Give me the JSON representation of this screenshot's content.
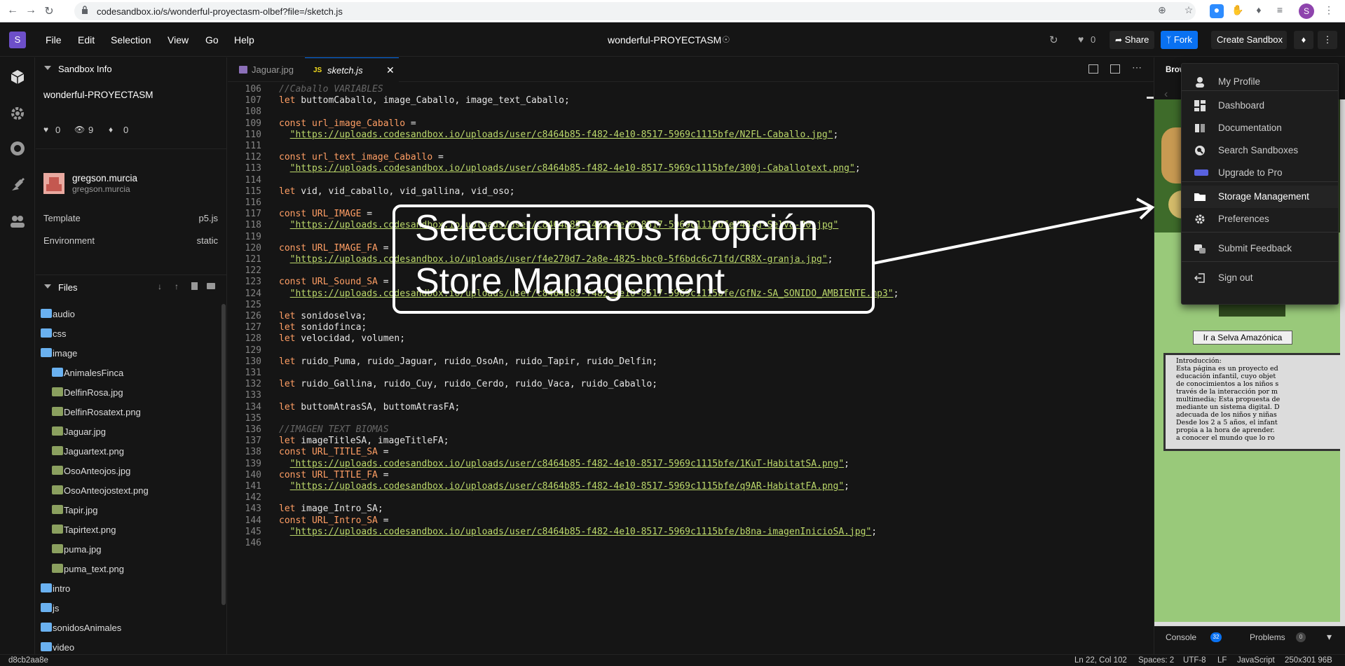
{
  "browser": {
    "url": "codesandbox.io/s/wonderful-proyectasm-olbef?file=/sketch.js",
    "profile_initial": "S"
  },
  "menubar": {
    "logo": "S",
    "items": [
      "File",
      "Edit",
      "Selection",
      "View",
      "Go",
      "Help"
    ],
    "sandbox_title": "wonderful-PROYECTASM",
    "likes": "0",
    "share_label": "Share",
    "fork_label": "Fork",
    "create_label": "Create Sandbox",
    "accent": "#0971f1"
  },
  "sidebar": {
    "info_header": "Sandbox Info",
    "sandbox_name": "wonderful-PROYECTASM",
    "stats": {
      "likes": "0",
      "views": "9",
      "forks": "0"
    },
    "author_name": "gregson.murcia",
    "author_handle": "gregson.murcia",
    "template_label": "Template",
    "template_value": "p5.js",
    "environment_label": "Environment",
    "environment_value": "static",
    "files_header": "Files",
    "files": [
      {
        "name": "audio",
        "type": "folder",
        "indent": 0
      },
      {
        "name": "css",
        "type": "folder",
        "indent": 0
      },
      {
        "name": "image",
        "type": "folder-open",
        "indent": 0
      },
      {
        "name": "AnimalesFinca",
        "type": "folder",
        "indent": 1
      },
      {
        "name": "DelfinRosa.jpg",
        "type": "image",
        "indent": 1
      },
      {
        "name": "DelfinRosatext.png",
        "type": "image",
        "indent": 1
      },
      {
        "name": "Jaguar.jpg",
        "type": "image",
        "indent": 1
      },
      {
        "name": "Jaguartext.png",
        "type": "image",
        "indent": 1
      },
      {
        "name": "OsoAnteojos.jpg",
        "type": "image",
        "indent": 1
      },
      {
        "name": "OsoAnteojostext.png",
        "type": "image",
        "indent": 1
      },
      {
        "name": "Tapir.jpg",
        "type": "image",
        "indent": 1
      },
      {
        "name": "Tapirtext.png",
        "type": "image",
        "indent": 1
      },
      {
        "name": "puma.jpg",
        "type": "image",
        "indent": 1
      },
      {
        "name": "puma_text.png",
        "type": "image",
        "indent": 1
      },
      {
        "name": "intro",
        "type": "folder",
        "indent": 0
      },
      {
        "name": "js",
        "type": "folder",
        "indent": 0
      },
      {
        "name": "sonidosAnimales",
        "type": "folder",
        "indent": 0
      },
      {
        "name": "video",
        "type": "folder",
        "indent": 0
      }
    ]
  },
  "tabs": [
    {
      "label": "Jaguar.jpg",
      "active": false
    },
    {
      "label": "sketch.js",
      "active": true
    }
  ],
  "code_lines": [
    {
      "n": "106",
      "html": "<span class=\"cm\">//Caballo VARIABLES</span>"
    },
    {
      "n": "107",
      "html": "<span class=\"kw\">let</span> buttomCaballo, image_Caballo, image_text_Caballo;"
    },
    {
      "n": "108",
      "html": ""
    },
    {
      "n": "109",
      "html": "<span class=\"kw\">const</span> <span class=\"kw\">url_image_Caballo</span> ="
    },
    {
      "n": "110",
      "html": "  <span class=\"str\">\"https://uploads.codesandbox.io/uploads/user/c8464b85-f482-4e10-8517-5969c1115bfe/N2FL-Caballo.jpg\"</span>;"
    },
    {
      "n": "111",
      "html": ""
    },
    {
      "n": "112",
      "html": "<span class=\"kw\">const</span> <span class=\"kw\">url_text_image_Caballo</span> ="
    },
    {
      "n": "113",
      "html": "  <span class=\"str\">\"https://uploads.codesandbox.io/uploads/user/c8464b85-f482-4e10-8517-5969c1115bfe/300j-Caballotext.png\"</span>;"
    },
    {
      "n": "114",
      "html": ""
    },
    {
      "n": "115",
      "html": "<span class=\"kw\">let</span> vid, vid_caballo, vid_gallina, vid_oso;"
    },
    {
      "n": "116",
      "html": ""
    },
    {
      "n": "117",
      "html": "<span class=\"kw\">const</span> <span class=\"kw\">URL_IMAGE</span> ="
    },
    {
      "n": "118",
      "html": "  <span class=\"str\">\"https://uploads.codesandbox.io/uploads/user/c8464b85-f482-4e10-8517-5969c1115bfe/48-g-Selva-80.jpg\"</span>"
    },
    {
      "n": "119",
      "html": ""
    },
    {
      "n": "120",
      "html": "<span class=\"kw\">const</span> <span class=\"kw\">URL_IMAGE_FA</span> ="
    },
    {
      "n": "121",
      "html": "  <span class=\"str\">\"https://uploads.codesandbox.io/uploads/user/f4e270d7-2a8e-4825-bbc0-5f6bdc6c71fd/CR8X-granja.jpg\"</span>;"
    },
    {
      "n": "122",
      "html": ""
    },
    {
      "n": "123",
      "html": "<span class=\"kw\">const</span> <span class=\"kw\">URL_Sound_SA</span> ="
    },
    {
      "n": "124",
      "html": "  <span class=\"str\">\"https://uploads.codesandbox.io/uploads/user/c8464b85-f482-4e10-8517-5969c1115bfe/GfNz-SA_SONIDO_AMBIENTE.mp3\"</span>;"
    },
    {
      "n": "125",
      "html": ""
    },
    {
      "n": "126",
      "html": "<span class=\"kw\">let</span> sonidoselva;"
    },
    {
      "n": "127",
      "html": "<span class=\"kw\">let</span> sonidofinca;"
    },
    {
      "n": "128",
      "html": "<span class=\"kw\">let</span> velocidad, volumen;"
    },
    {
      "n": "129",
      "html": ""
    },
    {
      "n": "130",
      "html": "<span class=\"kw\">let</span> ruido_Puma, ruido_Jaguar, ruido_OsoAn, ruido_Tapir, ruido_Delfin;"
    },
    {
      "n": "131",
      "html": ""
    },
    {
      "n": "132",
      "html": "<span class=\"kw\">let</span> ruido_Gallina, ruido_Cuy, ruido_Cerdo, ruido_Vaca, ruido_Caballo;"
    },
    {
      "n": "133",
      "html": ""
    },
    {
      "n": "134",
      "html": "<span class=\"kw\">let</span> buttomAtrasSA, buttomAtrasFA;"
    },
    {
      "n": "135",
      "html": ""
    },
    {
      "n": "136",
      "html": "<span class=\"cm\">//IMAGEN TEXT BIOMAS</span>"
    },
    {
      "n": "137",
      "html": "<span class=\"kw\">let</span> imageTitleSA, imageTitleFA;"
    },
    {
      "n": "138",
      "html": "<span class=\"kw\">const</span> <span class=\"kw\">URL_TITLE_SA</span> ="
    },
    {
      "n": "139",
      "html": "  <span class=\"str\">\"https://uploads.codesandbox.io/uploads/user/c8464b85-f482-4e10-8517-5969c1115bfe/1KuT-HabitatSA.png\"</span>;"
    },
    {
      "n": "140",
      "html": "<span class=\"kw\">const</span> <span class=\"kw\">URL_TITLE_FA</span> ="
    },
    {
      "n": "141",
      "html": "  <span class=\"str\">\"https://uploads.codesandbox.io/uploads/user/c8464b85-f482-4e10-8517-5969c1115bfe/q9AR-HabitatFA.png\"</span>;"
    },
    {
      "n": "142",
      "html": ""
    },
    {
      "n": "143",
      "html": "<span class=\"kw\">let</span> image_Intro_SA;"
    },
    {
      "n": "144",
      "html": "<span class=\"kw\">const</span> <span class=\"kw\">URL_Intro_SA</span> ="
    },
    {
      "n": "145",
      "html": "  <span class=\"str\">\"https://uploads.codesandbox.io/uploads/user/c8464b85-f482-4e10-8517-5969c1115bfe/b8na-imagenInicioSA.jpg\"</span>;"
    },
    {
      "n": "146",
      "html": ""
    }
  ],
  "preview": {
    "header": "Brow",
    "button_label": "Ir a Selva Amazónica",
    "intro_title": "Introducción:",
    "intro_lines": [
      "Esta página es un proyecto ed",
      "educación infantil, cuyo objet",
      "de conocimientos a los niños s",
      "través de la interacción por m",
      "multimedia; Esta propuesta de",
      "mediante un sistema digital. D",
      "adecuada de los niños y niñas",
      "Desde los 2 a 5 años, el infant",
      "propia a la hora de aprender.",
      "a conocer el mundo que lo ro"
    ],
    "console_label": "Console",
    "console_count": "32",
    "problems_label": "Problems",
    "problems_count": "0"
  },
  "dropdown": {
    "items": [
      {
        "label": "My Profile",
        "icon": "user-icon"
      },
      {
        "label": "Dashboard",
        "icon": "dashboard-icon"
      },
      {
        "label": "Documentation",
        "icon": "book-icon"
      },
      {
        "label": "Search Sandboxes",
        "icon": "search-icon"
      },
      {
        "label": "Upgrade to Pro",
        "icon": "pro-badge-icon"
      },
      {
        "label": "Storage Management",
        "icon": "folder-icon"
      },
      {
        "label": "Preferences",
        "icon": "gear-icon"
      },
      {
        "label": "Submit Feedback",
        "icon": "feedback-icon"
      },
      {
        "label": "Sign out",
        "icon": "sign-out-icon"
      }
    ]
  },
  "callout": {
    "line1": "Seleccionamos la opción",
    "line2": "Store Management"
  },
  "statusbar": {
    "commit": "d8cb2aa8e",
    "position": "Ln 22, Col 102",
    "spaces": "Spaces: 2",
    "encoding": "UTF-8",
    "eol": "LF",
    "language": "JavaScript",
    "size": "250x301 96B"
  }
}
